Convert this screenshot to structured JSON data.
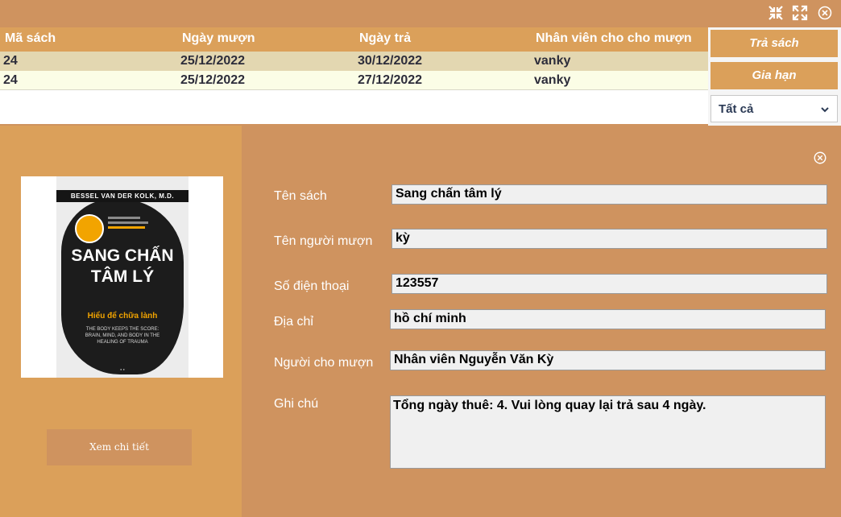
{
  "window": {
    "controls": [
      "minimize-icon",
      "maximize-icon",
      "close-icon"
    ]
  },
  "table": {
    "columns": [
      "Mã sách",
      "Ngày mượn",
      "Ngày trả",
      "Nhân viên cho cho mượn"
    ],
    "rows": [
      [
        "24",
        "25/12/2022",
        "30/12/2022",
        "vanky"
      ],
      [
        "24",
        "25/12/2022",
        "27/12/2022",
        "vanky"
      ]
    ]
  },
  "actions": {
    "return_label": "Trả sách",
    "extend_label": "Gia hạn",
    "filter_value": "Tất cả"
  },
  "book": {
    "cover": {
      "author": "BESSEL VAN DER KOLK, M.D.",
      "title": "SANG CHẤN TÂM LÝ",
      "subtitle": "Hiểu để chữa lành",
      "english": "THE BODY KEEPS THE SCORE: BRAIN, MIND, AND BODY IN THE HEALING OF TRAUMA"
    },
    "detail_button": "Xem chi tiết"
  },
  "form": {
    "book_name": {
      "label": "Tên sách",
      "value": "Sang chấn tâm lý"
    },
    "borrower": {
      "label": "Tên người mượn",
      "value": "kỳ"
    },
    "phone": {
      "label": "Số điện thoại",
      "value": "123557"
    },
    "address": {
      "label": "Địa chỉ",
      "value": "hồ chí minh"
    },
    "lender": {
      "label": "Người cho mượn",
      "value": "Nhân viên Nguyễn Văn Kỳ"
    },
    "note": {
      "label": "Ghi chú",
      "value": "Tổng ngày thuê: 4. Vui lòng quay lại trả sau 4 ngày."
    }
  },
  "colors": {
    "background": "#cf935f",
    "accent": "#dba05a",
    "row_selected": "#e3d7b1",
    "row_alt": "#fbfde6"
  }
}
